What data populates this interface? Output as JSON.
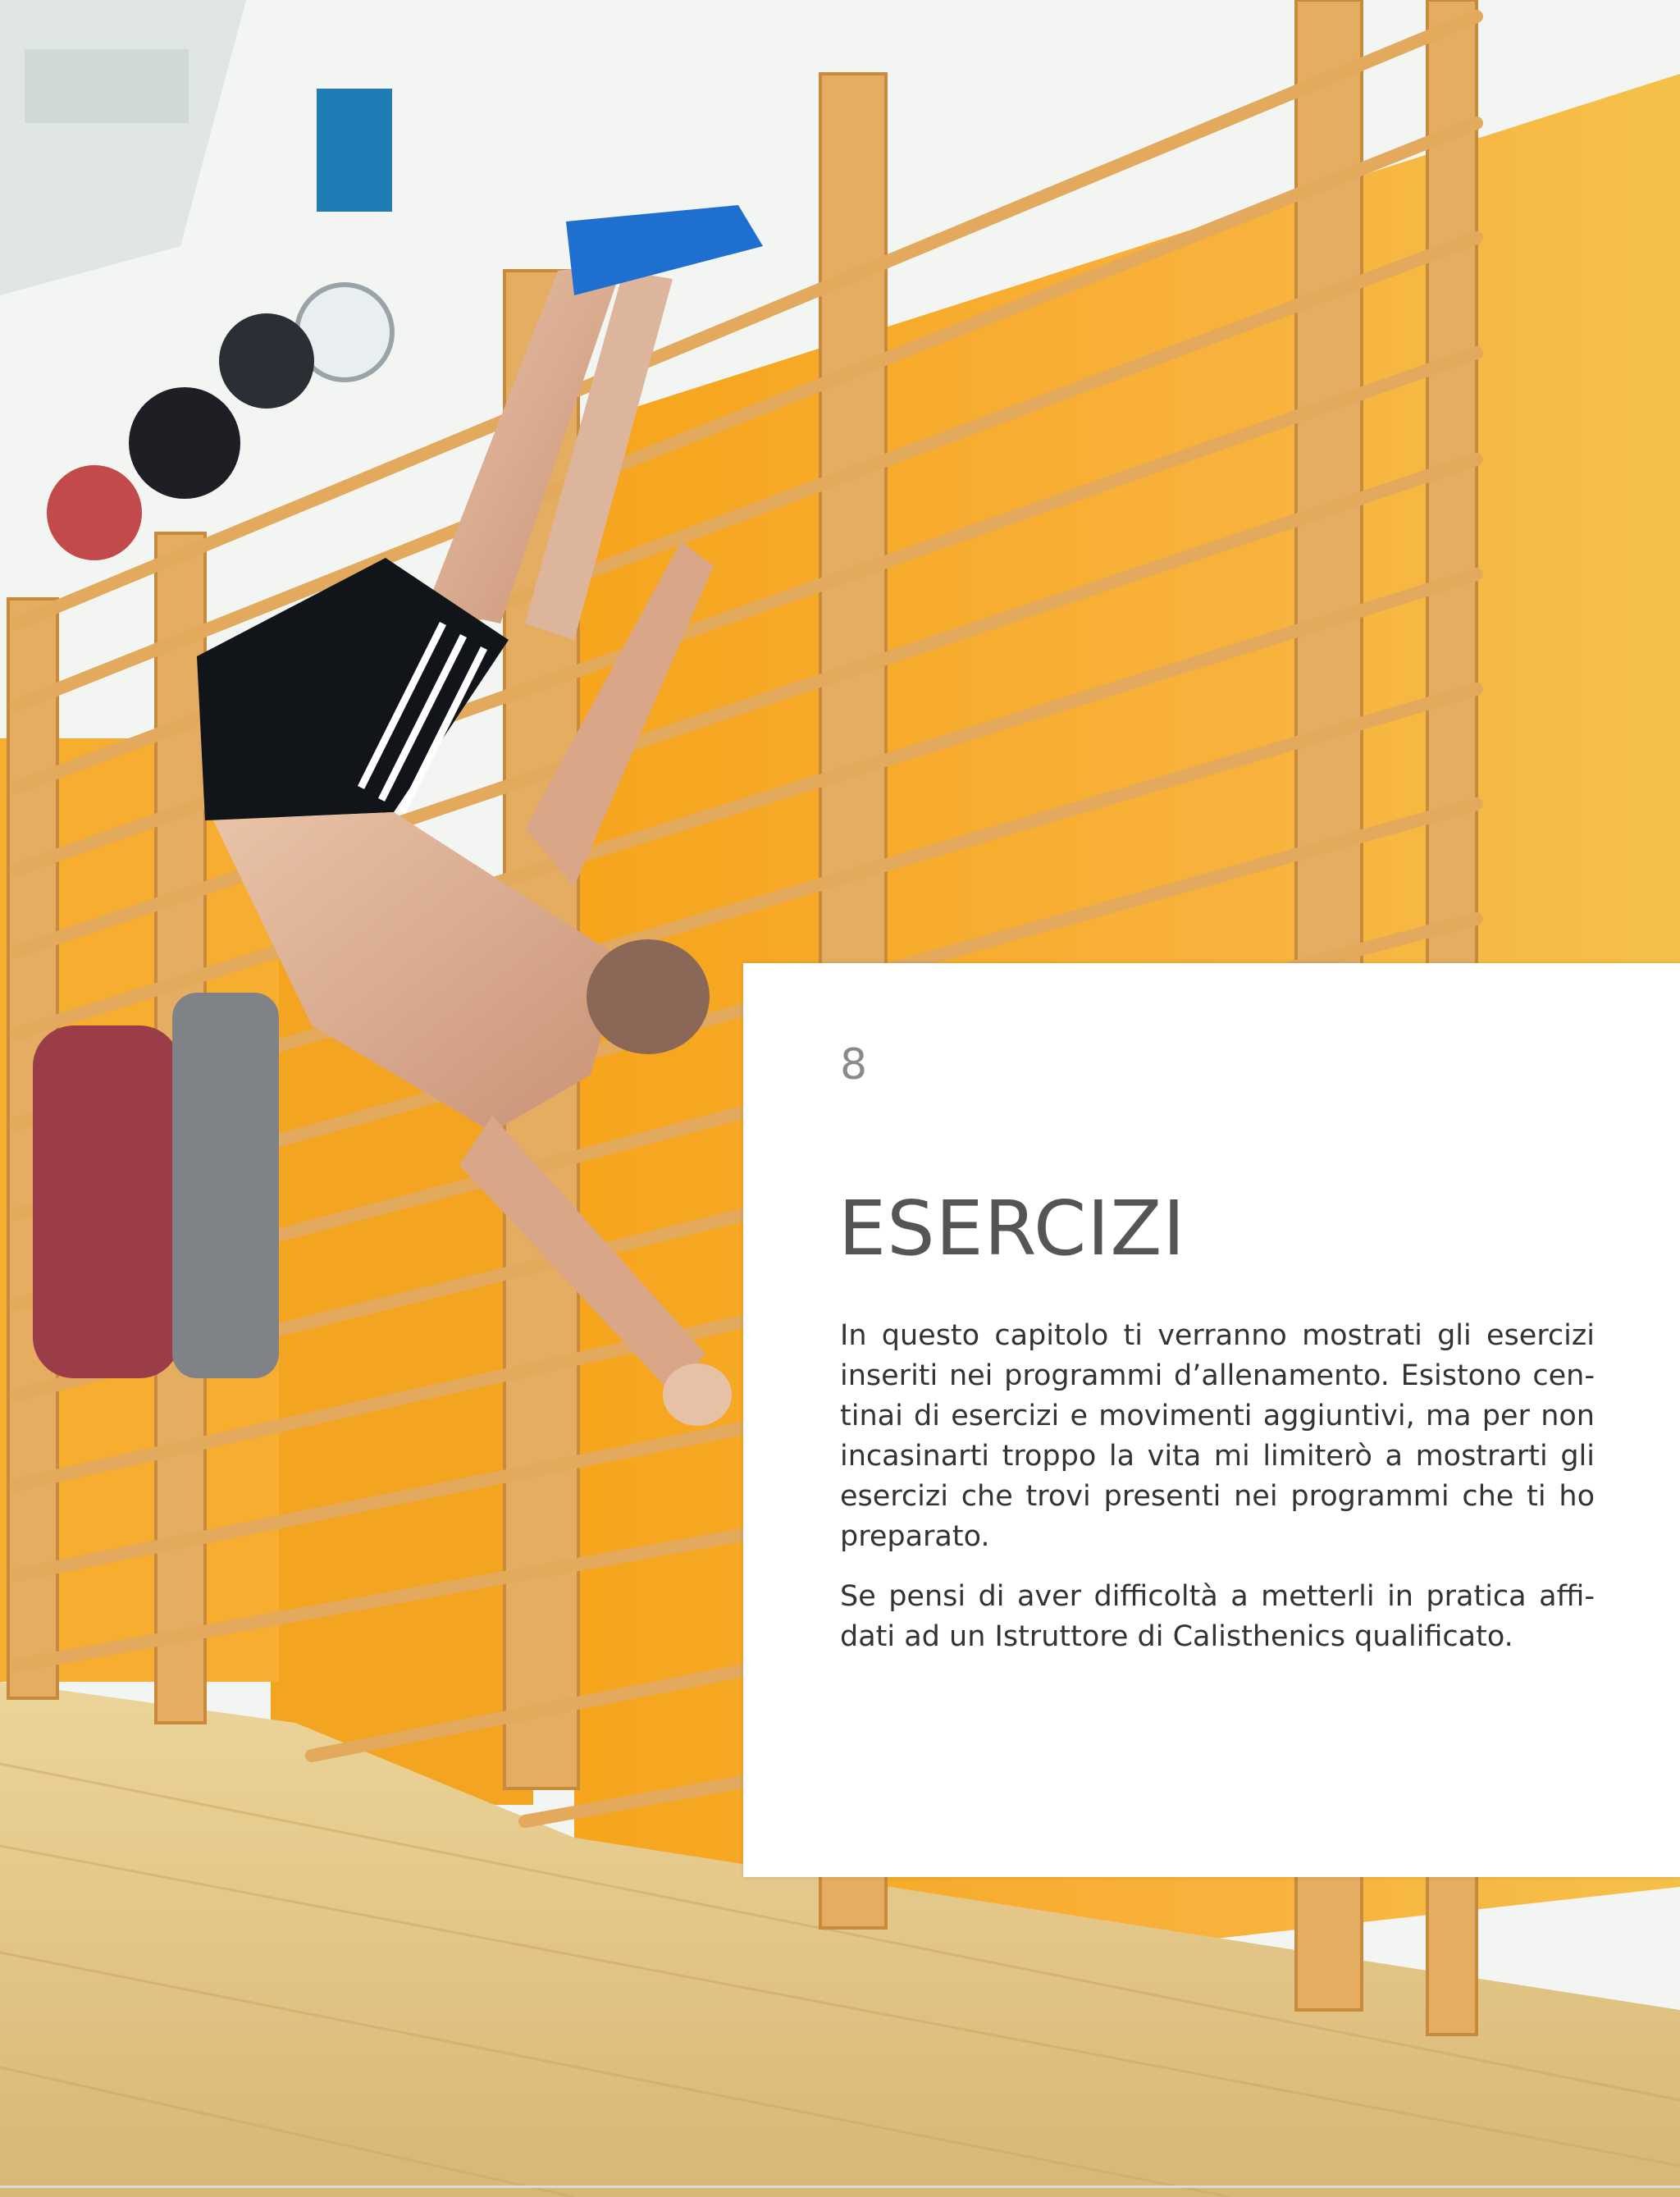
{
  "chapter": {
    "number": "8",
    "title": "ESERCIZI",
    "paragraphs": [
      "In questo capitolo ti verranno mostrati gli esercizi inseriti nei programmi d’allenamento. Esistono cen­tinai di esercizi e movimenti aggiuntivi, ma per non incasinarti troppo la vita mi limiterò a mostrarti gli esercizi che trovi presenti nei programmi che ti ho preparato.",
      "Se pensi di aver difficoltà a metterli in pratica affi­dati ad un Istruttore di Calisthenics qualificato."
    ]
  },
  "photo": {
    "subject": "athlete-doing-human-flag-on-wall-bars",
    "colors": {
      "wall_orange": "#f5a623",
      "wood": "#e8b36a",
      "floor": "#e6c98a",
      "wall_white": "#f4f6f4"
    }
  }
}
